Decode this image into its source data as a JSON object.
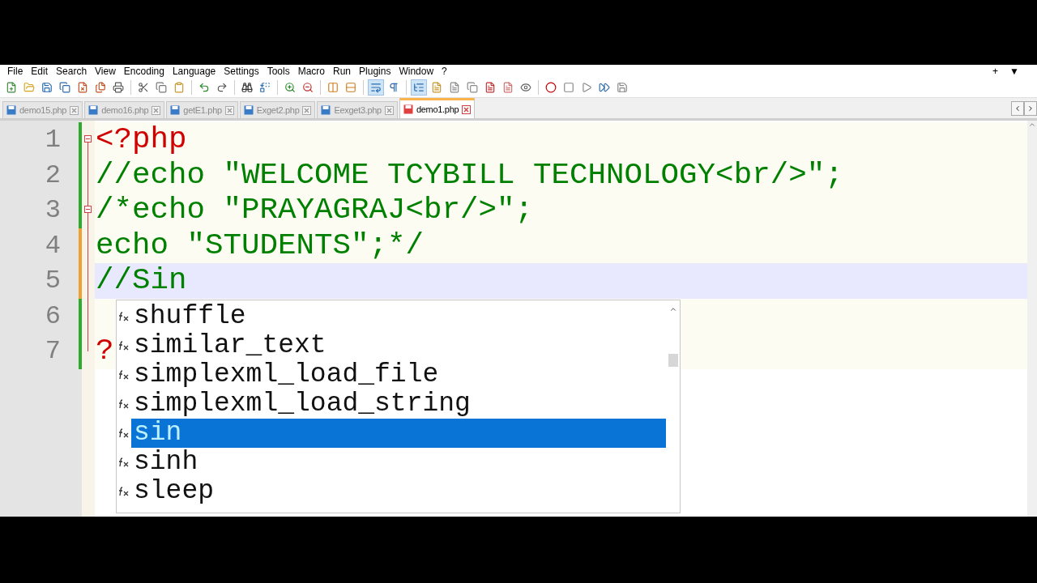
{
  "menu": [
    "File",
    "Edit",
    "Search",
    "View",
    "Encoding",
    "Language",
    "Settings",
    "Tools",
    "Macro",
    "Run",
    "Plugins",
    "Window",
    "?"
  ],
  "menu_right": [
    "+",
    "▼"
  ],
  "tabs": [
    {
      "label": "demo15.php",
      "selected": false,
      "modified": false
    },
    {
      "label": "demo16.php",
      "selected": false,
      "modified": false
    },
    {
      "label": "getE1.php",
      "selected": false,
      "modified": false
    },
    {
      "label": "Exget2.php",
      "selected": false,
      "modified": false
    },
    {
      "label": "Eexget3.php",
      "selected": false,
      "modified": false
    },
    {
      "label": "demo1.php",
      "selected": true,
      "modified": true
    }
  ],
  "editor": {
    "lines": [
      {
        "number": "1",
        "text": "<?php",
        "kind": "tag",
        "modified": false,
        "fold_marker": true,
        "current": false
      },
      {
        "number": "2",
        "text": "//echo \"WELCOME TCYBILL TECHNOLOGY<br/>\";",
        "kind": "comment",
        "modified": false,
        "fold_marker": false,
        "current": false
      },
      {
        "number": "3",
        "text": "/*echo \"PRAYAGRAJ<br/>\";",
        "kind": "comment",
        "modified": false,
        "fold_marker": true,
        "current": false
      },
      {
        "number": "4",
        "text": "echo \"STUDENTS\";*/",
        "kind": "comment",
        "modified": true,
        "fold_marker": false,
        "current": false
      },
      {
        "number": "5",
        "text": "//Sin",
        "kind": "comment",
        "modified": true,
        "fold_marker": false,
        "current": true
      },
      {
        "number": "6",
        "modified": false,
        "fold_marker": false,
        "current": false
      },
      {
        "number": "7",
        "text": "?",
        "kind": "tag",
        "modified": false,
        "fold_marker": false,
        "current": false
      }
    ]
  },
  "autocomplete": {
    "items": [
      {
        "label": "shuffle",
        "selected": false
      },
      {
        "label": "similar_text",
        "selected": false
      },
      {
        "label": "simplexml_load_file",
        "selected": false
      },
      {
        "label": "simplexml_load_string",
        "selected": false
      },
      {
        "label": "sin",
        "selected": true
      },
      {
        "label": "sinh",
        "selected": false
      },
      {
        "label": "sleep",
        "selected": false
      }
    ]
  }
}
